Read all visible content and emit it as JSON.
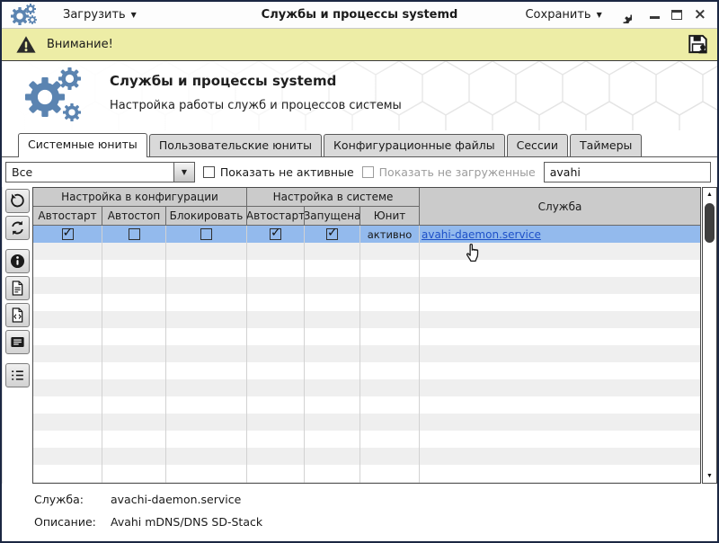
{
  "titlebar": {
    "load_button": "Загрузить",
    "title": "Службы и процессы systemd",
    "save_button": "Сохранить"
  },
  "warning_bar": {
    "label": "Внимание!"
  },
  "hero": {
    "title": "Службы и процессы systemd",
    "subtitle": "Настройка работы служб и процессов системы"
  },
  "tabs": [
    {
      "label": "Системные юниты",
      "active": true
    },
    {
      "label": "Пользовательские юниты",
      "active": false
    },
    {
      "label": "Конфигурационные файлы",
      "active": false
    },
    {
      "label": "Сессии",
      "active": false
    },
    {
      "label": "Таймеры",
      "active": false
    }
  ],
  "filters": {
    "category_value": "Все",
    "show_inactive": {
      "label": "Показать не активные",
      "checked": false,
      "enabled": true
    },
    "show_unloaded": {
      "label": "Показать не загруженные",
      "checked": false,
      "enabled": false
    },
    "search_value": "avahi"
  },
  "toolbar": {
    "groups": [
      [
        "history",
        "refresh"
      ],
      [
        "info",
        "document",
        "code-file",
        "list-view"
      ],
      [
        "bullet-list"
      ]
    ]
  },
  "table": {
    "groups": [
      {
        "label": "Настройка в конфигурации"
      },
      {
        "label": "Настройка в системе"
      },
      {
        "label": "Служба"
      }
    ],
    "columns": [
      "Автостарт",
      "Автостоп",
      "Блокировать",
      "Автостарт",
      "Запущена",
      "Юнит"
    ],
    "rows": [
      {
        "selected": true,
        "checks": [
          true,
          false,
          false,
          true,
          true
        ],
        "unit_state": "активно",
        "service_link": "avahi-daemon.service"
      }
    ],
    "empty_rows": 15
  },
  "status": {
    "service_label": "Служба:",
    "service_value": "avachi-daemon.service",
    "description_label": "Описание:",
    "description_value": "Avahi mDNS/DNS SD-Stack"
  },
  "colors": {
    "accent": "#5b84b1",
    "selected_row": "#93baed",
    "warning_bg": "#ededa6",
    "header_bg": "#cbcbcb",
    "link": "#1d50c8"
  }
}
